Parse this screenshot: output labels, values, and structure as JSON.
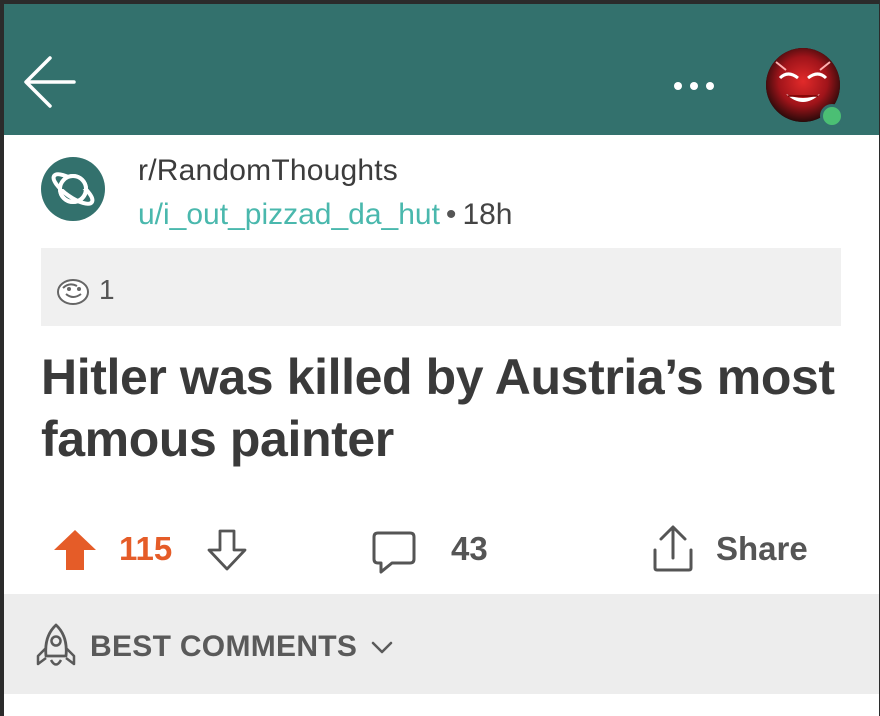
{
  "header": {
    "back_icon": "arrow-left-icon",
    "more_icon": "more-horizontal-icon",
    "background": "#33716d"
  },
  "post": {
    "subreddit": "r/RandomThoughts",
    "username": "u/i_out_pizzad_da_hut",
    "separator": "•",
    "time": "18h",
    "award_count": "1",
    "title": "Hitler was killed by Austria’s most famous painter",
    "score": "115",
    "comment_count": "43",
    "share_label": "Share"
  },
  "comments": {
    "sort_label": "BEST COMMENTS"
  },
  "colors": {
    "accent": "#4ab8ad",
    "upvote": "#e55c28",
    "online": "#4bbf74"
  }
}
